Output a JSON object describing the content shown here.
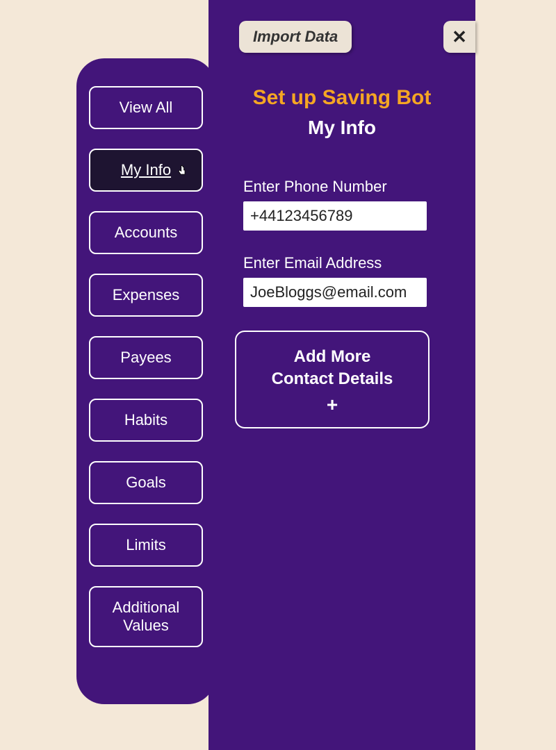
{
  "sidebar": {
    "items": [
      {
        "label": "View All",
        "active": false
      },
      {
        "label": "My Info",
        "active": true
      },
      {
        "label": "Accounts",
        "active": false
      },
      {
        "label": "Expenses",
        "active": false
      },
      {
        "label": "Payees",
        "active": false
      },
      {
        "label": "Habits",
        "active": false
      },
      {
        "label": "Goals",
        "active": false
      },
      {
        "label": "Limits",
        "active": false
      },
      {
        "label": "Additional Values",
        "active": false
      }
    ]
  },
  "topbar": {
    "import_label": "Import Data",
    "close_label": "✕"
  },
  "content": {
    "title": "Set up Saving Bot",
    "subtitle": "My Info",
    "phone_label": "Enter Phone Number",
    "phone_value": "+44123456789",
    "email_label": "Enter Email Address",
    "email_value": "JoeBloggs@email.com",
    "add_more_line1": "Add More",
    "add_more_line2": "Contact Details",
    "plus": "+"
  },
  "colors": {
    "panel_bg": "#43157a",
    "page_bg": "#f4e8d8",
    "accent": "#f5a623",
    "active_bg": "#1e1431"
  }
}
